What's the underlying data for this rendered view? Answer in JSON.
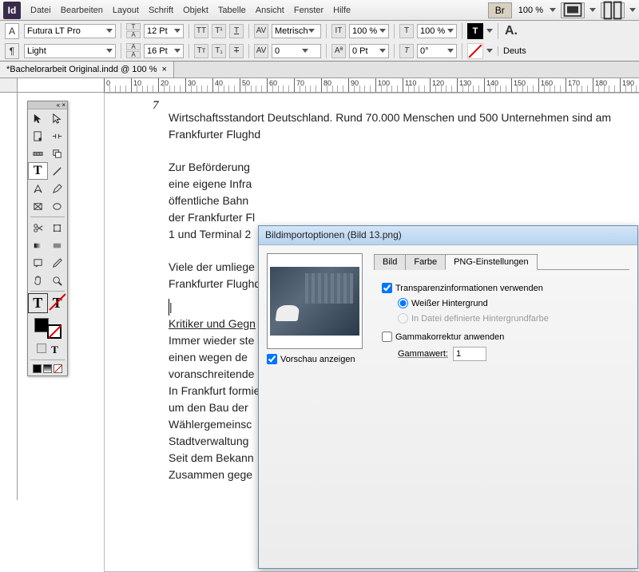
{
  "menu": {
    "items": [
      "Datei",
      "Bearbeiten",
      "Layout",
      "Schrift",
      "Objekt",
      "Tabelle",
      "Ansicht",
      "Fenster",
      "Hilfe"
    ],
    "zoom": "100 %",
    "br_label": "Br"
  },
  "opt": {
    "font": "Futura LT Pro",
    "style": "Light",
    "size": "12 Pt",
    "leading": "16 Pt",
    "kerning_mode": "Metrisch",
    "tracking": "0",
    "vscale": "100 %",
    "hscale": "100 %",
    "baseline": "0 Pt",
    "skew": "0°",
    "A_lbl": "A",
    "deuts": "Deuts"
  },
  "doctab": {
    "name": "*Bachelorarbeit Original.indd @ 100 %",
    "close": "×"
  },
  "page": {
    "num": "7",
    "p1": "Wirtschaftsstandort Deutschland. Rund 70.000 Menschen und 500 Unternehmen sind am\nFrankfurter Flughd",
    "p2": "Zur Beförderung\neine eigene Infra\nöffentliche Bahn\nder Frankfurter Fl\n1 und Terminal 2",
    "p3": "Viele der umliege\nFrankfurter Flughd",
    "h1": "Kritiker und Gegn",
    "p4": "Immer wieder ste\neinen wegen de\nvoranschreitende\nIn Frankfurt formie\num den Bau der\nWählergemeinsc\nStadtverwaltung\nSeit dem Bekann\nZusammen gege"
  },
  "dialog": {
    "title": "Bildimportoptionen (Bild 13.png)",
    "preview_chk": "Vorschau anzeigen",
    "tabs": [
      "Bild",
      "Farbe",
      "PNG-Einstellungen"
    ],
    "trans_chk": "Transparenzinformationen verwenden",
    "radio1": "Weißer Hintergrund",
    "radio2": "In Datei definierte Hintergrundfarbe",
    "gamma_chk": "Gammakorrektur anwenden",
    "gamma_lbl": "Gammawert:",
    "gamma_val": "1"
  },
  "ruler_vals": [
    "0",
    "10",
    "20",
    "30",
    "40",
    "50",
    "60",
    "70",
    "80",
    "90",
    "100",
    "110",
    "120",
    "130",
    "140",
    "150",
    "160",
    "170",
    "180",
    "190"
  ]
}
